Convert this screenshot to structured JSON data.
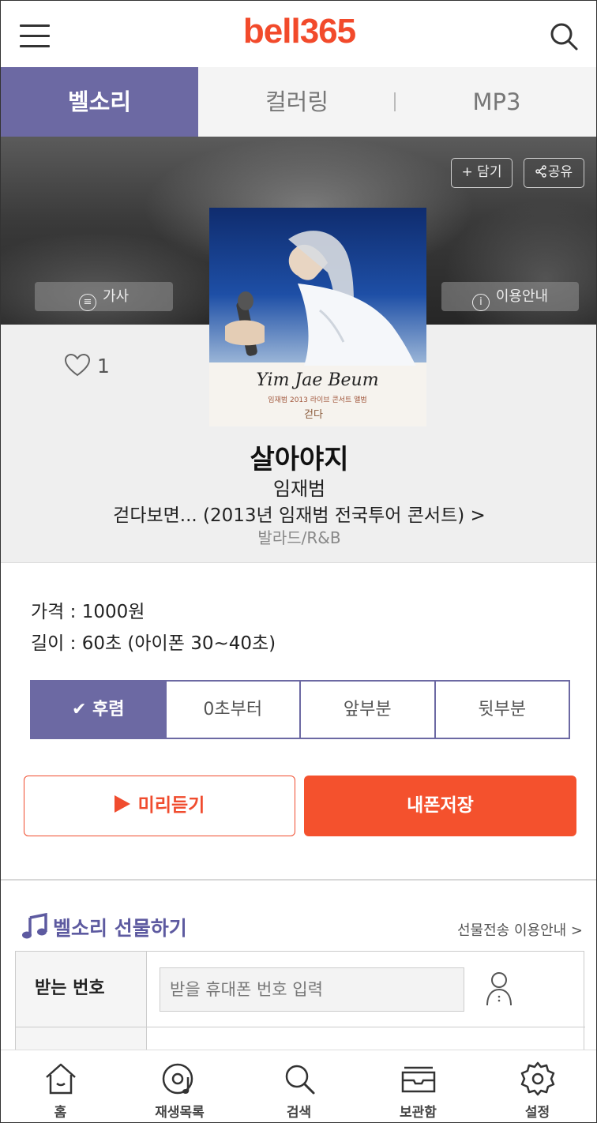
{
  "header": {
    "logo": "bell365"
  },
  "tabs": [
    {
      "label": "벨소리",
      "active": true
    },
    {
      "label": "컬러링",
      "active": false
    },
    {
      "label": "MP3",
      "active": false
    }
  ],
  "hero": {
    "keep_label": "+ 담기",
    "share_label": "공유",
    "lyrics_label": "가사",
    "info_label": "이용안내"
  },
  "album_art": {
    "script_title": "Yim Jae Beum",
    "subtitle": "임재범 2013 라이브 콘서트 앨범",
    "mark": "걷다"
  },
  "song": {
    "likes": "1",
    "title": "살아야지",
    "artist": "임재범",
    "album": "걷다보면... (2013년 임재범 전국투어 콘서트) >",
    "genre": "발라드/R&B"
  },
  "details": {
    "price": "가격 : 1000원",
    "length": "길이 : 60초 (아이폰 30~40초)"
  },
  "segments": [
    {
      "label": "✔ 후렴",
      "active": true
    },
    {
      "label": "0초부터",
      "active": false
    },
    {
      "label": "앞부분",
      "active": false
    },
    {
      "label": "뒷부분",
      "active": false
    }
  ],
  "actions": {
    "preview_label": "미리듣기",
    "save_label": "내폰저장"
  },
  "gift": {
    "title": "벨소리 선물하기",
    "guide_link": "선물전송 이용안내 >",
    "receiver_label": "받는 번호",
    "receiver_placeholder": "받을 휴대폰 번호 입력"
  },
  "bottom_nav": [
    {
      "label": "홈",
      "icon": "home-icon"
    },
    {
      "label": "재생목록",
      "icon": "playlist-icon"
    },
    {
      "label": "검색",
      "icon": "search-icon"
    },
    {
      "label": "보관함",
      "icon": "storage-icon"
    },
    {
      "label": "설정",
      "icon": "settings-icon"
    }
  ],
  "colors": {
    "brand": "#f24a2b",
    "accent": "#6c69a3",
    "save_button": "#f4512d"
  }
}
